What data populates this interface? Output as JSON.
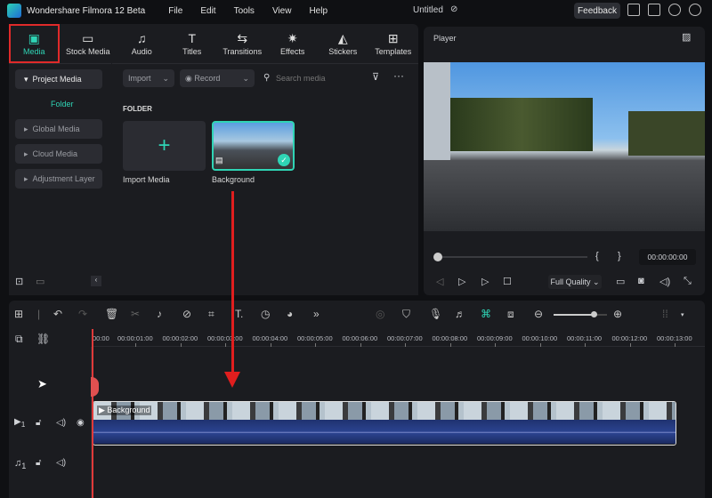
{
  "app": {
    "title": "Wondershare Filmora 12 Beta",
    "menu": [
      "File",
      "Edit",
      "Tools",
      "View",
      "Help"
    ],
    "document": "Untitled",
    "feedback": "Feedback"
  },
  "tabs": [
    {
      "label": "Media",
      "icon": "media-icon",
      "active": true
    },
    {
      "label": "Stock Media",
      "icon": "cloud-folder-icon"
    },
    {
      "label": "Audio",
      "icon": "music-icon"
    },
    {
      "label": "Titles",
      "icon": "text-icon"
    },
    {
      "label": "Transitions",
      "icon": "transition-icon"
    },
    {
      "label": "Effects",
      "icon": "sparkle-icon"
    },
    {
      "label": "Stickers",
      "icon": "sticker-icon"
    },
    {
      "label": "Templates",
      "icon": "template-icon"
    }
  ],
  "sidebar": {
    "items": [
      "Project Media",
      "Folder",
      "Global Media",
      "Cloud Media",
      "Adjustment Layer"
    ]
  },
  "media": {
    "import": "Import",
    "record": "Record",
    "search_placeholder": "Search media",
    "folder_heading": "FOLDER",
    "import_tile": "Import Media",
    "clip_tile": "Background"
  },
  "player": {
    "title": "Player",
    "timecode": "00:00:00:00",
    "quality": "Full Quality",
    "progress": 0
  },
  "timeline": {
    "ticks": [
      "00:00",
      "00:00:01:00",
      "00:00:02:00",
      "00:00:03:00",
      "00:00:04:00",
      "00:00:05:00",
      "00:00:06:00",
      "00:00:07:00",
      "00:00:08:00",
      "00:00:09:00",
      "00:00:10:00",
      "00:00:11:00",
      "00:00:12:00",
      "00:00:13:00"
    ],
    "clip_label": "Background",
    "video_track": "1",
    "audio_track": "1",
    "zoom_level": 0.75
  },
  "colors": {
    "accent": "#2fd4b5",
    "highlight": "#e02a2a",
    "playhead": "#e03a3a"
  }
}
